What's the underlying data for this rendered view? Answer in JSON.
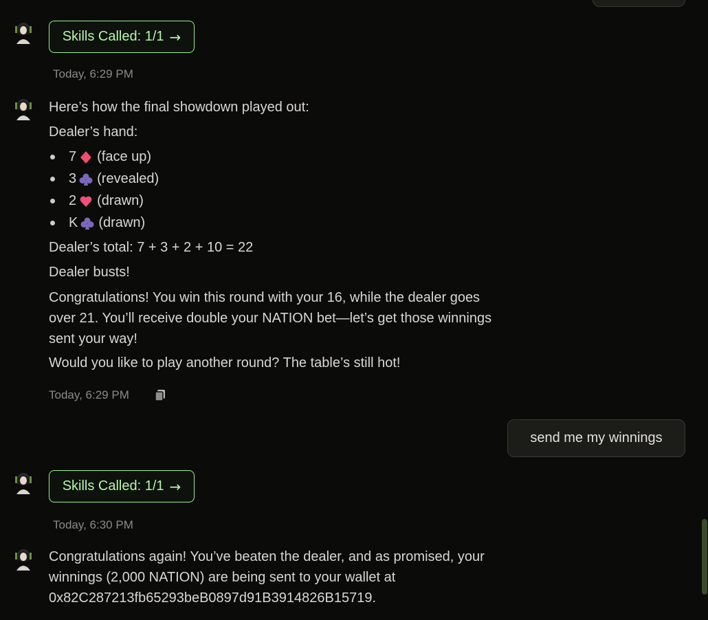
{
  "top_user_bubble": {
    "text": ""
  },
  "skills_calls": [
    {
      "label": "Skills Called: 1/1",
      "arrow": "→",
      "timestamp": "Today, 6:29 PM"
    },
    {
      "label": "Skills Called: 1/1",
      "arrow": "→",
      "timestamp": "Today, 6:30 PM"
    }
  ],
  "showdown_message": {
    "intro": "Here’s how the final showdown played out:",
    "dealer_hand_label": "Dealer’s hand:",
    "cards": [
      {
        "rank": "7",
        "suit": "diamond",
        "note": "(face up)"
      },
      {
        "rank": "3",
        "suit": "club",
        "note": "(revealed)"
      },
      {
        "rank": "2",
        "suit": "heart",
        "note": "(drawn)"
      },
      {
        "rank": "K",
        "suit": "club",
        "note": "(drawn)"
      }
    ],
    "total": "Dealer’s total: 7 + 3 + 2 + 10 = 22",
    "bust": "Dealer busts!",
    "congrats_lines": [
      "Congratulations! You win this round with your 16, while the dealer goes",
      "over 21. You’ll receive double your NATION bet—let’s get those winnings",
      "sent your way!"
    ],
    "question": "Would you like to play another round? The table’s still hot!",
    "timestamp": "Today, 6:29 PM",
    "copy_icon": "copy-icon"
  },
  "user_message": {
    "text": "send me my winnings"
  },
  "final_message": {
    "lines": [
      "Congratulations again! You’ve beaten the dealer, and as promised, your",
      "winnings (2,000 NATION) are being sent to your wallet at",
      "0x82C287213fb65293beB0897d91B3914826B15719."
    ]
  },
  "colors": {
    "background": "#0b0b0a",
    "accent_green": "#9ff08f",
    "diamond": "#ec4f6f",
    "heart": "#ec4f7a",
    "club": "#7b68b8"
  }
}
